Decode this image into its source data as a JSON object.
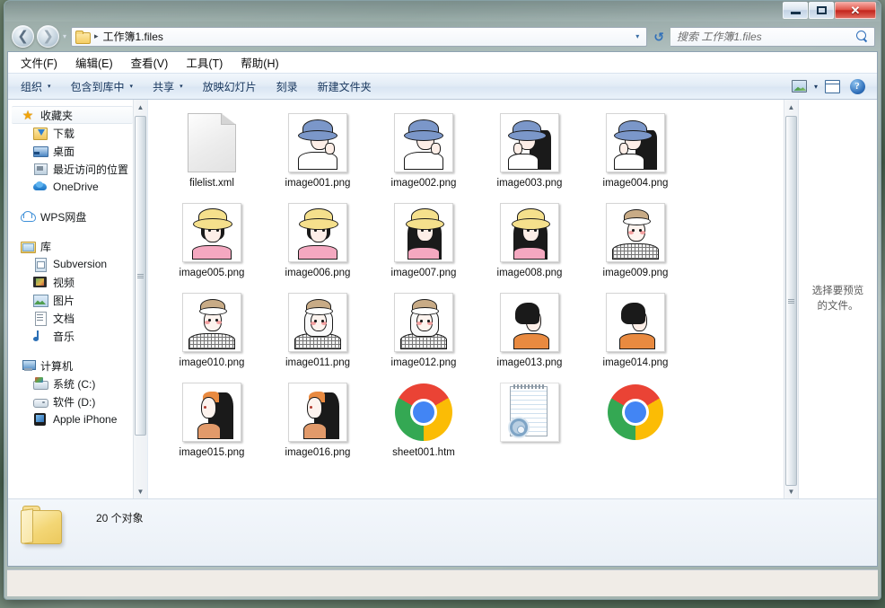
{
  "window": {
    "minimize_label": "–",
    "maximize_label": "□",
    "close_label": "✕"
  },
  "address": {
    "back_glyph": "←",
    "forward_glyph": "→",
    "history_caret": "▾",
    "separator": "▸",
    "path": "工作簿1.files",
    "dropdown_caret": "▾",
    "refresh_glyph": "↺"
  },
  "search": {
    "placeholder": "搜索 工作簿1.files"
  },
  "menubar": {
    "items": [
      {
        "label": "文件(F)"
      },
      {
        "label": "编辑(E)"
      },
      {
        "label": "查看(V)"
      },
      {
        "label": "工具(T)"
      },
      {
        "label": "帮助(H)"
      }
    ]
  },
  "toolbar": {
    "items": [
      {
        "label": "组织",
        "caret": "▾"
      },
      {
        "label": "包含到库中",
        "caret": "▾"
      },
      {
        "label": "共享",
        "caret": "▾"
      },
      {
        "label": "放映幻灯片",
        "caret": ""
      },
      {
        "label": "刻录",
        "caret": ""
      },
      {
        "label": "新建文件夹",
        "caret": ""
      }
    ],
    "view_caret": "▾",
    "help_label": "?"
  },
  "sidebar": {
    "groups": [
      {
        "header": {
          "label": "收藏夹",
          "icon": "star-icon",
          "selected": true
        },
        "items": [
          {
            "label": "下载",
            "icon": "download-folder-icon"
          },
          {
            "label": "桌面",
            "icon": "desktop-icon"
          },
          {
            "label": "最近访问的位置",
            "icon": "recent-places-icon"
          },
          {
            "label": "OneDrive",
            "icon": "onedrive-icon"
          }
        ]
      },
      {
        "header": {
          "label": "WPS网盘",
          "icon": "wps-cloud-icon",
          "selected": false
        },
        "items": []
      },
      {
        "header": {
          "label": "库",
          "icon": "library-icon",
          "selected": false
        },
        "items": [
          {
            "label": "Subversion",
            "icon": "subversion-icon"
          },
          {
            "label": "视频",
            "icon": "video-icon"
          },
          {
            "label": "图片",
            "icon": "pictures-icon"
          },
          {
            "label": "文档",
            "icon": "documents-icon"
          },
          {
            "label": "音乐",
            "icon": "music-icon"
          }
        ]
      },
      {
        "header": {
          "label": "计算机",
          "icon": "computer-icon",
          "selected": false
        },
        "items": [
          {
            "label": "系统 (C:)",
            "icon": "drive-c-icon"
          },
          {
            "label": "软件 (D:)",
            "icon": "drive-d-icon"
          },
          {
            "label": "Apple iPhone",
            "icon": "iphone-icon"
          }
        ]
      }
    ],
    "scroll_up": "▲",
    "scroll_down": "▼"
  },
  "files": {
    "items": [
      {
        "name": "filelist.xml",
        "icon": "xml-document-icon"
      },
      {
        "name": "image001.png",
        "icon": "image-thumbnail",
        "style": "blue-hat-profile"
      },
      {
        "name": "image002.png",
        "icon": "image-thumbnail",
        "style": "blue-hat-profile"
      },
      {
        "name": "image003.png",
        "icon": "image-thumbnail",
        "style": "blue-hat-black-hair"
      },
      {
        "name": "image004.png",
        "icon": "image-thumbnail",
        "style": "blue-hat-black-hair"
      },
      {
        "name": "image005.png",
        "icon": "image-thumbnail",
        "style": "yellow-hat-pink-top"
      },
      {
        "name": "image006.png",
        "icon": "image-thumbnail",
        "style": "yellow-hat-pink-top"
      },
      {
        "name": "image007.png",
        "icon": "image-thumbnail",
        "style": "yellow-hat-black-hair"
      },
      {
        "name": "image008.png",
        "icon": "image-thumbnail",
        "style": "yellow-hat-black-hair"
      },
      {
        "name": "image009.png",
        "icon": "image-thumbnail",
        "style": "beige-bonnet-check"
      },
      {
        "name": "image010.png",
        "icon": "image-thumbnail",
        "style": "beige-bonnet-check"
      },
      {
        "name": "image011.png",
        "icon": "image-thumbnail",
        "style": "beige-bonnet-white-hair"
      },
      {
        "name": "image012.png",
        "icon": "image-thumbnail",
        "style": "beige-bonnet-white-hair"
      },
      {
        "name": "image013.png",
        "icon": "image-thumbnail",
        "style": "orange-shirt-profile"
      },
      {
        "name": "image014.png",
        "icon": "image-thumbnail",
        "style": "orange-shirt-profile"
      },
      {
        "name": "image015.png",
        "icon": "image-thumbnail",
        "style": "long-black-hair-orange"
      },
      {
        "name": "image016.png",
        "icon": "image-thumbnail",
        "style": "long-black-hair-orange"
      },
      {
        "name": "sheet001.htm",
        "icon": "chrome-icon"
      },
      {
        "name": "",
        "icon": "config-file-icon"
      },
      {
        "name": "",
        "icon": "chrome-icon"
      }
    ]
  },
  "preview": {
    "line1": "选择要预览",
    "line2": "的文件。"
  },
  "status": {
    "count_text": "20 个对象"
  }
}
